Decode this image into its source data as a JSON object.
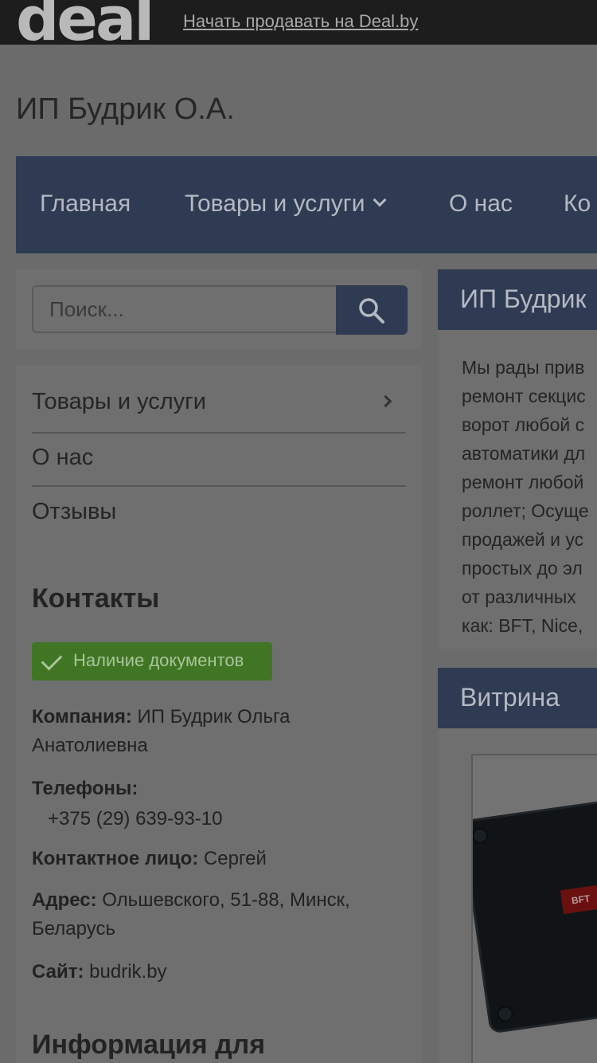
{
  "header": {
    "logo": "deal",
    "sell_link": "Начать продавать на Deal.by"
  },
  "company_title": "ИП Будрик О.А.",
  "nav": {
    "items": [
      "Главная",
      "Товары и услуги",
      "О нас",
      "Ко"
    ]
  },
  "search": {
    "placeholder": "Поиск..."
  },
  "sidebar": {
    "links": [
      "Товары и услуги",
      "О нас",
      "Отзывы"
    ],
    "contacts_heading": "Контакты",
    "docs_badge": "Наличие документов",
    "company_label": "Компания:",
    "company_value_1": "ИП Будрик Ольга",
    "company_value_2": "Анатолиевна",
    "phones_label": "Телефоны:",
    "phone": "+375 (29) 639-93-10",
    "contact_label": "Контактное лицо:",
    "contact_value": "Сергей",
    "address_label": "Адрес:",
    "address_value_1": "Ольшевского, 51-88, Минск,",
    "address_value_2": "Беларусь",
    "site_label": "Сайт:",
    "site_value": "budrik.by",
    "info_heading": "Информация для"
  },
  "about": {
    "header": "ИП Будрик",
    "lines": [
      "Мы рады прив",
      "ремонт секцис",
      "ворот любой с",
      "автоматики дл",
      "ремонт любой",
      "роллет; Осуще",
      "продажей и ус",
      "простых до эл",
      "от различных",
      "как: BFT, Nice,"
    ]
  },
  "showcase": {
    "header": "Витрина",
    "product_brand": "BFT"
  },
  "colors": {
    "nav_bg": "#2f3b52",
    "docs_badge": "#3f7523",
    "overlay": "dimmed"
  }
}
